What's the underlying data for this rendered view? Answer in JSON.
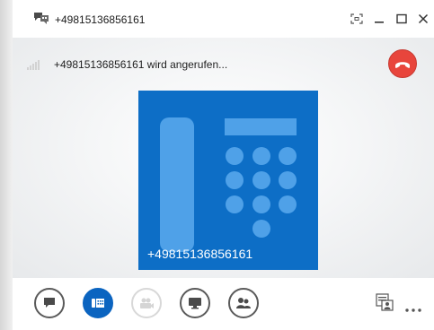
{
  "window": {
    "title": "+49815136856161"
  },
  "call": {
    "status": "+49815136856161 wird angerufen...",
    "contact_number": "+49815136856161"
  },
  "colors": {
    "accent": "#0b64c0",
    "tile": "#0d6ec6",
    "hangup": "#e8453c"
  },
  "toolbar": {
    "buttons": [
      "chat-icon",
      "dialpad-icon",
      "video-icon",
      "present-screen-icon",
      "participants-icon"
    ],
    "right": [
      "contact-card-icon",
      "more-options-icon"
    ]
  }
}
